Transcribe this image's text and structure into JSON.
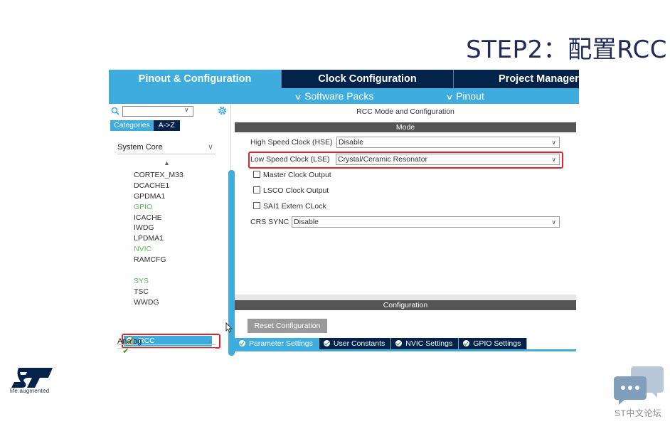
{
  "slide": {
    "title": "STEP2：配置RCC",
    "logo_tagline": "life.augmented",
    "forum_label": "ST中文论坛"
  },
  "top_tabs": [
    {
      "label": "Pinout & Configuration"
    },
    {
      "label": "Clock Configuration"
    },
    {
      "label": "Project Manager"
    }
  ],
  "sub_bar": {
    "software_packs": "Software Packs",
    "pinout": "Pinout"
  },
  "left_panel": {
    "search": {
      "value": ""
    },
    "category_tabs": [
      "Categories",
      "A->Z"
    ],
    "section_system_core": "System Core",
    "section_analog": "Analog",
    "components": [
      {
        "label": "CORTEX_M33",
        "state": "normal"
      },
      {
        "label": "DCACHE1",
        "state": "normal"
      },
      {
        "label": "GPDMA1",
        "state": "normal"
      },
      {
        "label": "GPIO",
        "state": "green"
      },
      {
        "label": "ICACHE",
        "state": "normal"
      },
      {
        "label": "IWDG",
        "state": "normal"
      },
      {
        "label": "LPDMA1",
        "state": "normal"
      },
      {
        "label": "NVIC",
        "state": "green"
      },
      {
        "label": "RAMCFG",
        "state": "normal"
      },
      {
        "label": "RCC",
        "state": "selected"
      },
      {
        "label": "SYS",
        "state": "checked"
      },
      {
        "label": "TSC",
        "state": "normal"
      },
      {
        "label": "WWDG",
        "state": "normal"
      }
    ]
  },
  "right_panel": {
    "title": "RCC Mode and Configuration",
    "mode_header": "Mode",
    "hse": {
      "label": "High Speed Clock (HSE)",
      "value": "Disable"
    },
    "lse": {
      "label": "Low Speed Clock (LSE)",
      "value": "Crystal/Ceramic Resonator"
    },
    "checkboxes": [
      {
        "label": "Master Clock Output",
        "checked": false
      },
      {
        "label": "LSCO Clock Output",
        "checked": false
      },
      {
        "label": "SAI1 Extern CLock",
        "checked": false
      }
    ],
    "crs": {
      "label": "CRS SYNC",
      "value": "Disable"
    },
    "config_header": "Configuration",
    "reset_button": "Reset Configuration",
    "config_tabs": [
      "Parameter Settings",
      "User Constants",
      "NVIC Settings",
      "GPIO Settings"
    ]
  },
  "colors": {
    "accent": "#3eacdd",
    "dark_navy": "#03234b",
    "highlight_red": "#e2242a",
    "ok_green": "#3a9d3a"
  }
}
